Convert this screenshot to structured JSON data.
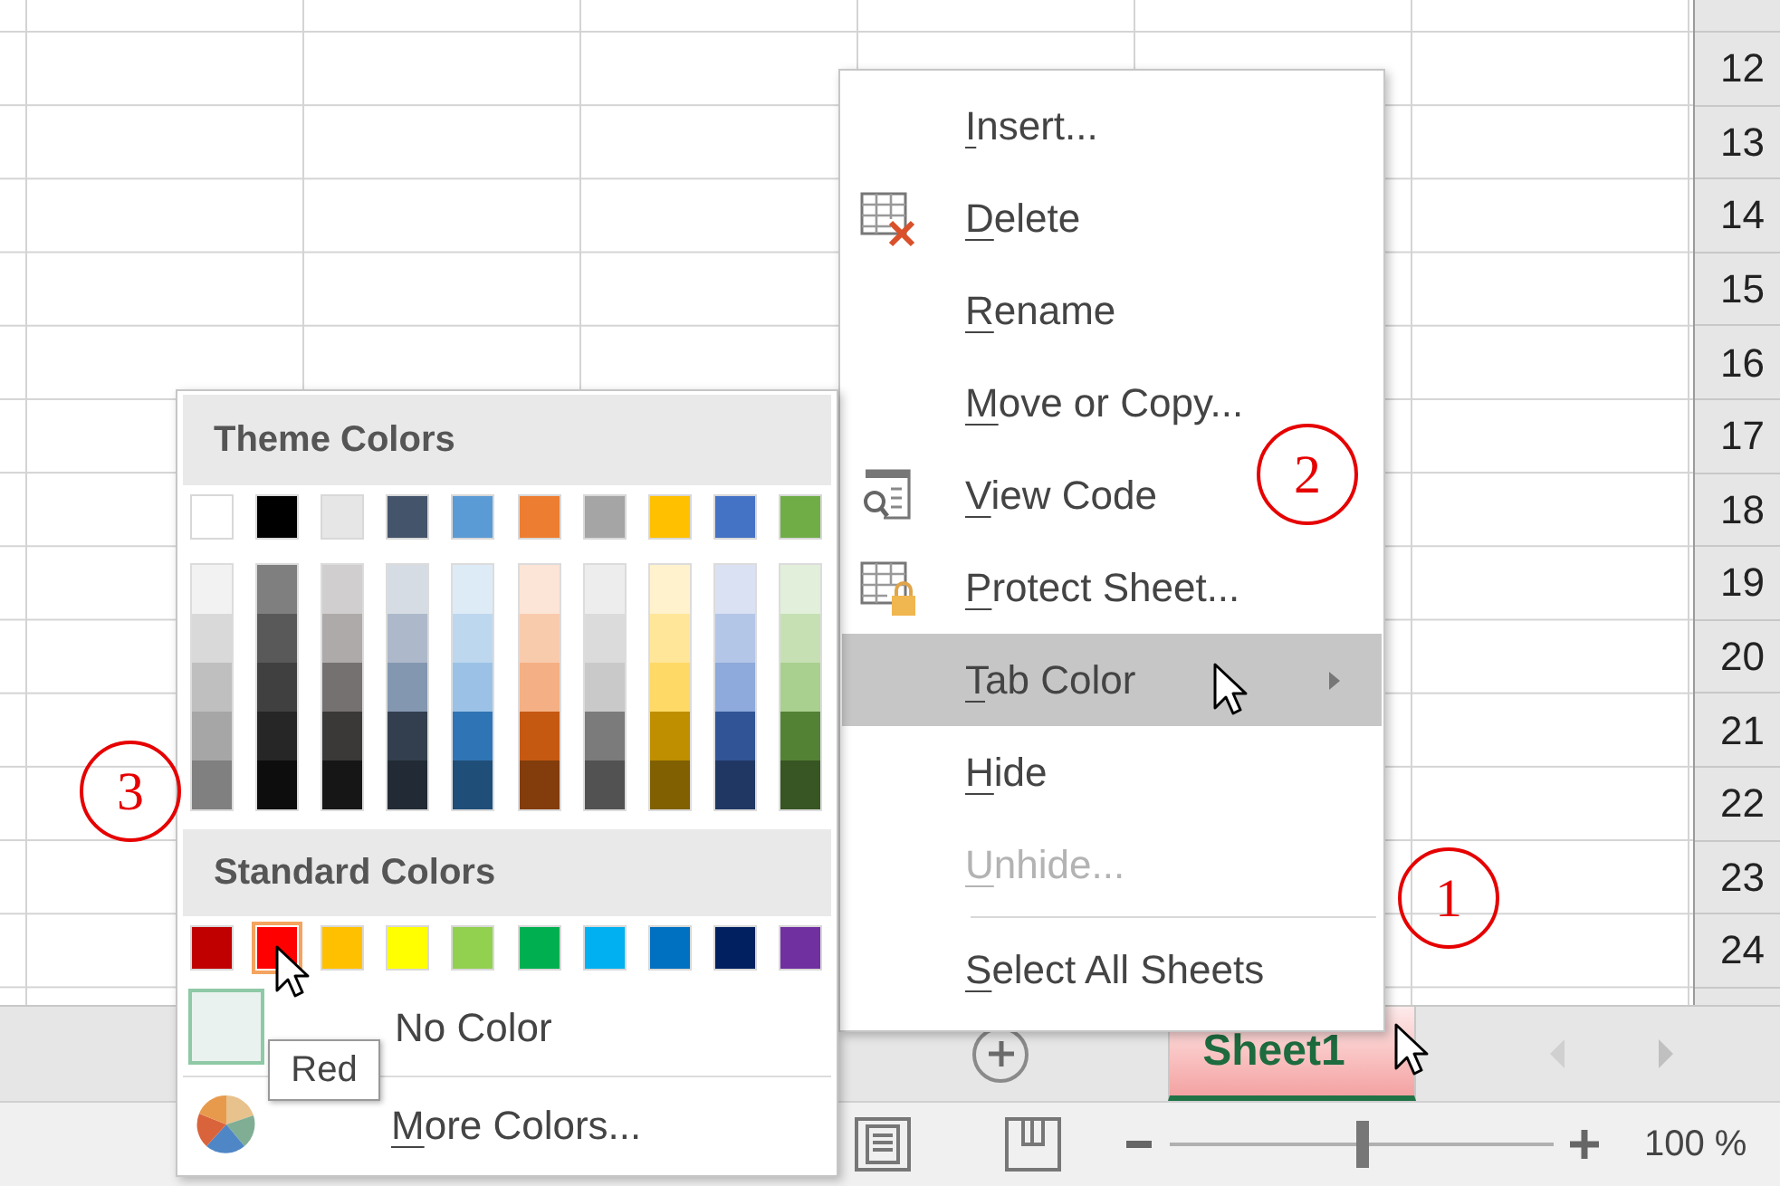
{
  "sheet": {
    "row_headers": [
      "12",
      "13",
      "14",
      "15",
      "16",
      "17",
      "18",
      "19",
      "20",
      "21",
      "22",
      "23",
      "24"
    ]
  },
  "context_menu": {
    "items": [
      {
        "label": "Insert...",
        "kind": "plain",
        "highlighted": false,
        "disabled": false,
        "has_submenu": false,
        "separator_before": false
      },
      {
        "label": "Delete",
        "kind": "delete",
        "highlighted": false,
        "disabled": false,
        "has_submenu": false,
        "separator_before": false
      },
      {
        "label": "Rename",
        "kind": "plain",
        "highlighted": false,
        "disabled": false,
        "has_submenu": false,
        "separator_before": false
      },
      {
        "label": "Move or Copy...",
        "kind": "plain",
        "highlighted": false,
        "disabled": false,
        "has_submenu": false,
        "separator_before": false
      },
      {
        "label": "View Code",
        "kind": "view-code",
        "highlighted": false,
        "disabled": false,
        "has_submenu": false,
        "separator_before": false
      },
      {
        "label": "Protect Sheet...",
        "kind": "protect",
        "highlighted": false,
        "disabled": false,
        "has_submenu": false,
        "separator_before": false
      },
      {
        "label": "Tab Color",
        "kind": "plain",
        "highlighted": true,
        "disabled": false,
        "has_submenu": true,
        "separator_before": false
      },
      {
        "label": "Hide",
        "kind": "plain",
        "highlighted": false,
        "disabled": false,
        "has_submenu": false,
        "separator_before": false
      },
      {
        "label": "Unhide...",
        "kind": "plain",
        "highlighted": false,
        "disabled": true,
        "has_submenu": false,
        "separator_before": false
      },
      {
        "label": "Select All Sheets",
        "kind": "plain",
        "highlighted": false,
        "disabled": false,
        "has_submenu": false,
        "separator_before": true
      }
    ]
  },
  "color_palette": {
    "theme_header": "Theme Colors",
    "theme_colors": [
      {
        "color": "#ffffff",
        "shades": [
          {
            "color": "#f2f2f2"
          },
          {
            "color": "#d9d9d9"
          },
          {
            "color": "#bfbfbf"
          },
          {
            "color": "#a6a6a6"
          },
          {
            "color": "#808080"
          }
        ]
      },
      {
        "color": "#000000",
        "shades": [
          {
            "color": "#7f7f7f"
          },
          {
            "color": "#595959"
          },
          {
            "color": "#404040"
          },
          {
            "color": "#262626"
          },
          {
            "color": "#0d0d0d"
          }
        ]
      },
      {
        "color": "#e7e6e6",
        "shades": [
          {
            "color": "#d0cece"
          },
          {
            "color": "#aeaaaa"
          },
          {
            "color": "#757171"
          },
          {
            "color": "#3b3838"
          },
          {
            "color": "#171616"
          }
        ]
      },
      {
        "color": "#44546a",
        "shades": [
          {
            "color": "#d6dce4"
          },
          {
            "color": "#adb9ca"
          },
          {
            "color": "#8497b0"
          },
          {
            "color": "#333f4f"
          },
          {
            "color": "#222b35"
          }
        ]
      },
      {
        "color": "#5b9bd5",
        "shades": [
          {
            "color": "#ddebf7"
          },
          {
            "color": "#bdd7ee"
          },
          {
            "color": "#9bc2e6"
          },
          {
            "color": "#2f75b5"
          },
          {
            "color": "#1f4e78"
          }
        ]
      },
      {
        "color": "#ed7d31",
        "shades": [
          {
            "color": "#fce4d6"
          },
          {
            "color": "#f8cbad"
          },
          {
            "color": "#f4b084"
          },
          {
            "color": "#c65911"
          },
          {
            "color": "#833c0c"
          }
        ]
      },
      {
        "color": "#a5a5a5",
        "shades": [
          {
            "color": "#ededed"
          },
          {
            "color": "#dbdbdb"
          },
          {
            "color": "#c9c9c9"
          },
          {
            "color": "#7b7b7b"
          },
          {
            "color": "#525252"
          }
        ]
      },
      {
        "color": "#ffc000",
        "shades": [
          {
            "color": "#fff2cc"
          },
          {
            "color": "#ffe699"
          },
          {
            "color": "#ffd966"
          },
          {
            "color": "#bf8f00"
          },
          {
            "color": "#806000"
          }
        ]
      },
      {
        "color": "#4472c4",
        "shades": [
          {
            "color": "#d9e1f2"
          },
          {
            "color": "#b4c6e7"
          },
          {
            "color": "#8ea9db"
          },
          {
            "color": "#305496"
          },
          {
            "color": "#203764"
          }
        ]
      },
      {
        "color": "#70ad47",
        "shades": [
          {
            "color": "#e2efda"
          },
          {
            "color": "#c6e0b4"
          },
          {
            "color": "#a9d08e"
          },
          {
            "color": "#548235"
          },
          {
            "color": "#375623"
          }
        ]
      }
    ],
    "standard_header": "Standard Colors",
    "standard_colors": [
      {
        "color": "#c00000",
        "selected": false
      },
      {
        "color": "#ff0000",
        "selected": true
      },
      {
        "color": "#ffc000",
        "selected": false
      },
      {
        "color": "#ffff00",
        "selected": false
      },
      {
        "color": "#92d050",
        "selected": false
      },
      {
        "color": "#00b050",
        "selected": false
      },
      {
        "color": "#00b0f0",
        "selected": false
      },
      {
        "color": "#0070c0",
        "selected": false
      },
      {
        "color": "#002060",
        "selected": false
      },
      {
        "color": "#7030a0",
        "selected": false
      }
    ],
    "no_color": "No Color",
    "more_colors": "More Colors...",
    "tooltip": "Red"
  },
  "sheet_tabs": [
    {
      "label": "Sheet1",
      "selected": true
    }
  ],
  "status_bar": {
    "zoom_slider": {
      "level": 0.5
    },
    "zoom_percent": "100 %"
  },
  "annotations": [
    {
      "number": "2"
    },
    {
      "number": "1"
    },
    {
      "number": "3"
    }
  ]
}
